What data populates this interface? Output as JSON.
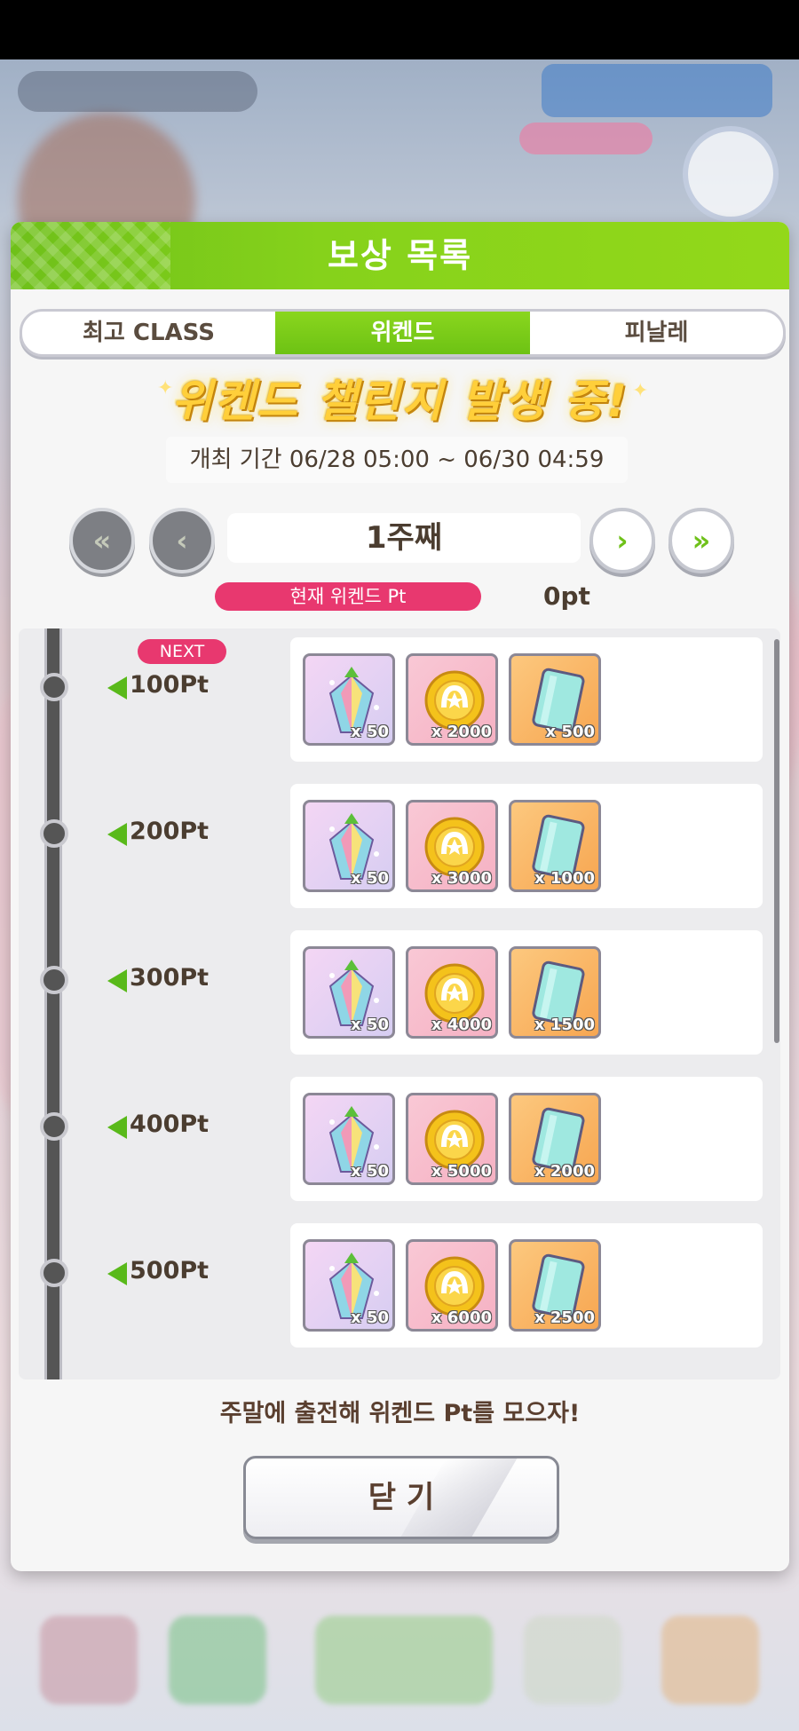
{
  "dialog": {
    "title": "보상 목록",
    "tabs": [
      {
        "label": "최고 CLASS",
        "active": false
      },
      {
        "label": "위켄드",
        "active": true
      },
      {
        "label": "피날레",
        "active": false
      }
    ],
    "banner": "위켄드 챌린지 발생 중!",
    "period": "개최 기간 06/28 05:00 ~ 06/30 04:59",
    "week_label": "1주째",
    "current_pt_label": "현재 위켄드 Pt",
    "current_pt_value": "0pt",
    "next_badge": "NEXT",
    "tiers": [
      {
        "pt": "100Pt",
        "rewards": [
          {
            "type": "carrot-jewel",
            "qty": "x 50"
          },
          {
            "type": "coin",
            "qty": "x 2000"
          },
          {
            "type": "ticket",
            "qty": "x 500"
          }
        ]
      },
      {
        "pt": "200Pt",
        "rewards": [
          {
            "type": "carrot-jewel",
            "qty": "x 50"
          },
          {
            "type": "coin",
            "qty": "x 3000"
          },
          {
            "type": "ticket",
            "qty": "x 1000"
          }
        ]
      },
      {
        "pt": "300Pt",
        "rewards": [
          {
            "type": "carrot-jewel",
            "qty": "x 50"
          },
          {
            "type": "coin",
            "qty": "x 4000"
          },
          {
            "type": "ticket",
            "qty": "x 1500"
          }
        ]
      },
      {
        "pt": "400Pt",
        "rewards": [
          {
            "type": "carrot-jewel",
            "qty": "x 50"
          },
          {
            "type": "coin",
            "qty": "x 5000"
          },
          {
            "type": "ticket",
            "qty": "x 2000"
          }
        ]
      },
      {
        "pt": "500Pt",
        "rewards": [
          {
            "type": "carrot-jewel",
            "qty": "x 50"
          },
          {
            "type": "coin",
            "qty": "x 6000"
          },
          {
            "type": "ticket",
            "qty": "x 2500"
          }
        ]
      }
    ],
    "hint": "주말에 출전해 위켄드 Pt를 모으자!",
    "close_label": "닫 기"
  },
  "colors": {
    "accent_green": "#7cc81a",
    "badge_pink": "#e8386f",
    "text_brown": "#4b3d30"
  },
  "icons": {
    "first_page": "double-chevron-left-icon",
    "prev_page": "chevron-left-icon",
    "next_page": "chevron-right-icon",
    "last_page": "double-chevron-right-icon"
  }
}
